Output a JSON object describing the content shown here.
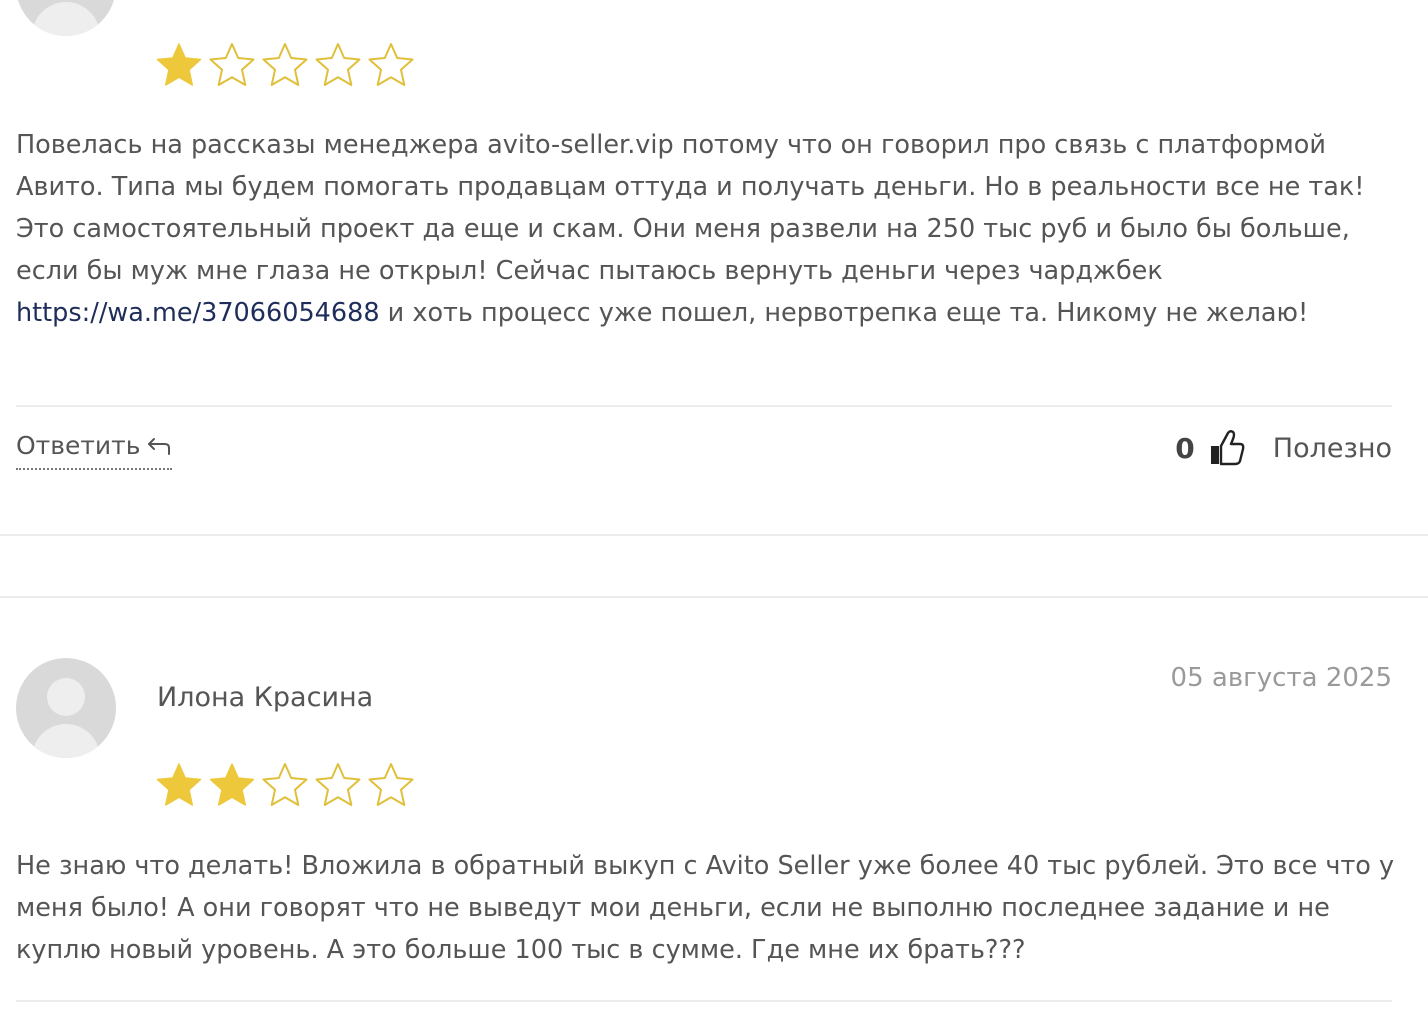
{
  "review1": {
    "rating": 1,
    "rating_max": 5,
    "text_before_link": "Повелась на рассказы менеджера avito-seller.vip потому что он говорил про связь с платформой Авито. Типа мы будем помогать продавцам оттуда и получать деньги. Но в реальности все не так! Это самостоятельный проект да еще и скам. Они меня развели на 250 тыс руб и было бы больше, если бы муж мне глаза не открыл! Сейчас пытаюсь вернуть деньги через чарджбек ",
    "link_text": "https://wa.me/37066054688",
    "text_after_link": " и хоть процесс уже пошел, нервотрепка еще та. Никому не желаю!",
    "reply_label": "Ответить",
    "useful_count": "0",
    "useful_label": "Полезно"
  },
  "review2": {
    "author": "Илона Красина",
    "date": "05 августа 2025",
    "rating": 2,
    "rating_max": 5,
    "text": "Не знаю что делать! Вложила в обратный выкуп с Avito Seller уже более 40 тыс рублей. Это все что у меня было! А они говорят что не выведут мои деньги, если не выполню последнее задание и не куплю новый уровень. А это больше 100 тыс в сумме. Где мне их брать???"
  },
  "colors": {
    "star_filled": "#ecc83a",
    "star_outline": "#e0bf3a",
    "link": "#1f2d5a",
    "text": "#555555",
    "date": "#9a9a9a",
    "divider": "#ececec"
  },
  "icons": {
    "reply": "reply-arrow-icon",
    "useful": "thumbs-up-icon",
    "avatar": "user-placeholder-icon"
  }
}
